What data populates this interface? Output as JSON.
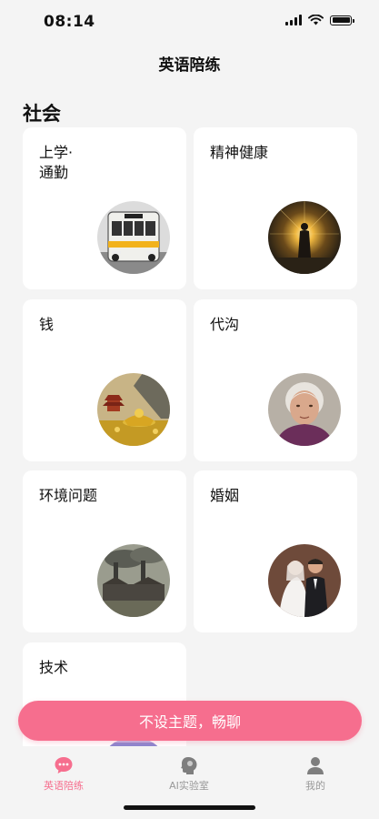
{
  "status": {
    "time": "08:14"
  },
  "nav": {
    "title": "英语陪练"
  },
  "section": {
    "title": "社会"
  },
  "topics": [
    {
      "label": "上学·\n通勤",
      "icon": "bus-image"
    },
    {
      "label": "精神健康",
      "icon": "silhouette-light-image"
    },
    {
      "label": "钱",
      "icon": "gold-treasure-image"
    },
    {
      "label": "代沟",
      "icon": "elderly-woman-image"
    },
    {
      "label": "环境问题",
      "icon": "factory-pollution-image"
    },
    {
      "label": "婚姻",
      "icon": "wedding-couple-image"
    },
    {
      "label": "技术",
      "icon": "technology-image"
    }
  ],
  "cta": {
    "label": "不设主题，畅聊"
  },
  "tabs": [
    {
      "label": "英语陪练",
      "icon": "chat-bubble-icon",
      "active": true
    },
    {
      "label": "AI实验室",
      "icon": "head-brain-icon",
      "active": false
    },
    {
      "label": "我的",
      "icon": "profile-icon",
      "active": false
    }
  ],
  "colors": {
    "accent": "#f66e8e",
    "background": "#f4f4f4",
    "card": "#ffffff"
  }
}
